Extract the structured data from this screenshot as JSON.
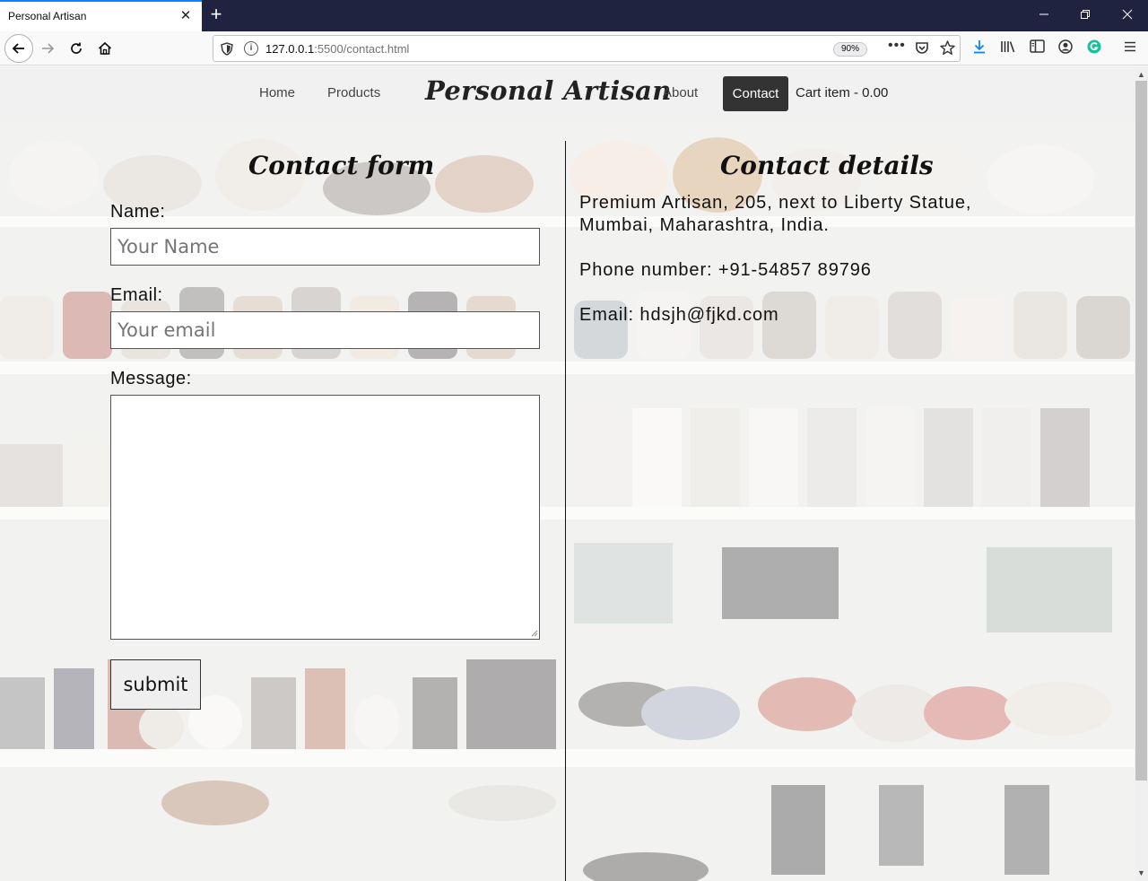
{
  "browser": {
    "tab_title": "Personal Artisan",
    "tab_close": "✕",
    "new_tab": "+",
    "url_host": "127.0.0.1",
    "url_path": ":5500/contact.html",
    "zoom": "90%",
    "more_actions": "•••"
  },
  "site": {
    "brand": "Personal Artisan",
    "nav": {
      "home": "Home",
      "products": "Products",
      "about": "About",
      "contact": "Contact",
      "cart": "Cart item - 0.00"
    }
  },
  "contact_form": {
    "title": "Contact form",
    "name_label": "Name:",
    "name_placeholder": "Your Name",
    "email_label": "Email:",
    "email_placeholder": "Your email",
    "message_label": "Message:",
    "submit_label": "submit"
  },
  "contact_details": {
    "title": "Contact details",
    "address_line1": "Premium Artisan, 205, next to Liberty Statue,",
    "address_line2": "Mumbai, Maharashtra, India.",
    "phone": "Phone number: +91-54857 89796",
    "email": "Email: hdsjh@fjkd.com"
  },
  "icons": {
    "back": "back-arrow-icon",
    "forward": "forward-arrow-icon",
    "reload": "reload-icon",
    "home": "home-icon",
    "download": "download-icon",
    "library": "library-icon",
    "sidebar": "sidebar-icon",
    "account": "account-icon",
    "grammarly": "grammarly-icon",
    "menu": "hamburger-menu-icon"
  },
  "colors": {
    "tabbar": "#1f2340",
    "active_nav": "#333333",
    "header_bg": "#f1f1f1",
    "accent": "#0a84ff"
  }
}
